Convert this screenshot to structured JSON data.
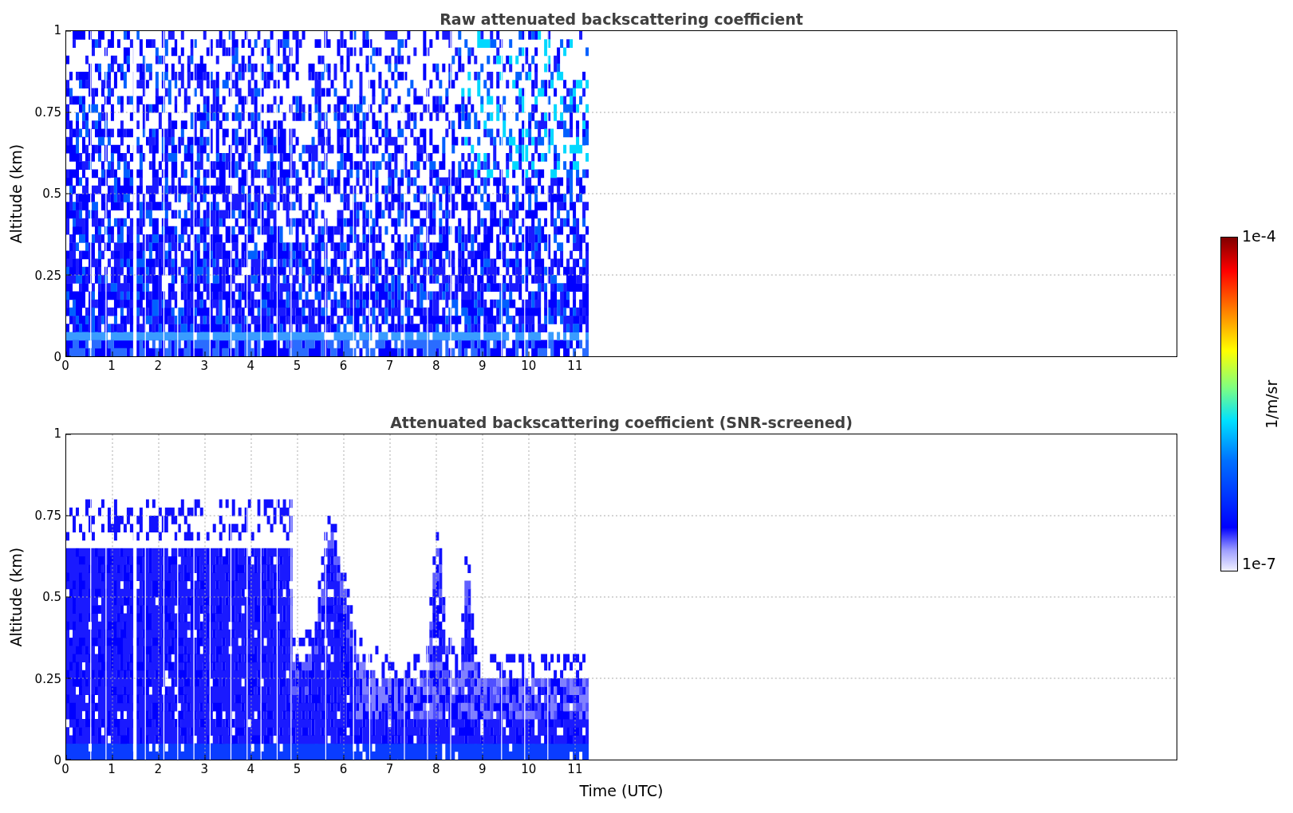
{
  "panels": [
    {
      "kind": "raw",
      "title": "Raw attenuated backscattering coefficient",
      "ylabel": "Altitude (km)",
      "yticks": [
        "1",
        "0.75",
        "0.5",
        "0.25",
        "0"
      ],
      "xticks": [
        "0",
        "1",
        "2",
        "3",
        "4",
        "5",
        "6",
        "7",
        "8",
        "9",
        "10",
        "11"
      ]
    },
    {
      "kind": "screened",
      "title": "Attenuated backscattering coefficient (SNR-screened)",
      "ylabel": "Altitude (km)",
      "yticks": [
        "1",
        "0.75",
        "0.5",
        "0.25",
        "0"
      ],
      "xticks": [
        "0",
        "1",
        "2",
        "3",
        "4",
        "5",
        "6",
        "7",
        "8",
        "9",
        "10",
        "11"
      ]
    }
  ],
  "xlabel": "Time (UTC)",
  "colorbar": {
    "label": "1/m/sr",
    "max": "1e-4",
    "min": "1e-7"
  }
}
